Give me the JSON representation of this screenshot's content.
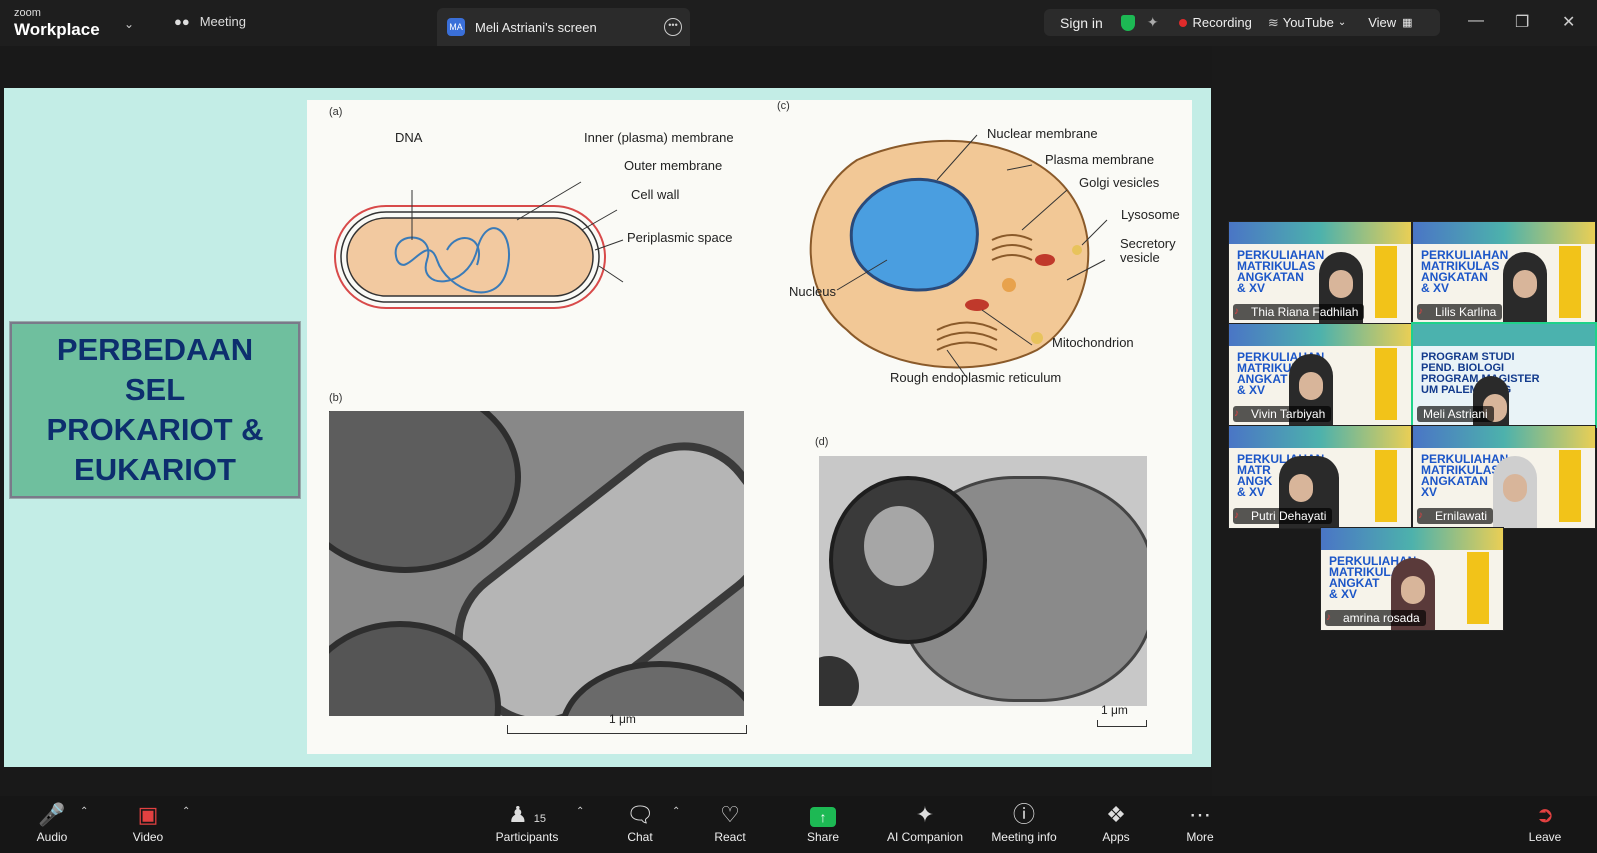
{
  "app": {
    "brand_small": "zoom",
    "brand_big": "Workplace",
    "meeting_label": "Meeting",
    "screen_title": "Meli Astriani's screen",
    "screen_avatar": "MA"
  },
  "top_right": {
    "sign_in": "Sign in",
    "recording": "Recording",
    "youtube": "YouTube",
    "view": "View"
  },
  "slide": {
    "title_lines": [
      "PERBEDAAN",
      "SEL",
      "PROKARIOT &",
      "EUKARIOT"
    ],
    "panel_a": "(a)",
    "panel_b": "(b)",
    "panel_c": "(c)",
    "panel_d": "(d)",
    "prok_labels": {
      "dna": "DNA",
      "inner": "Inner (plasma) membrane",
      "outer": "Outer membrane",
      "wall": "Cell wall",
      "peri": "Periplasmic space"
    },
    "euk_labels": {
      "nuclear": "Nuclear membrane",
      "plasma": "Plasma membrane",
      "golgi": "Golgi vesicles",
      "lyso": "Lysosome",
      "secr1": "Secretory",
      "secr2": "vesicle",
      "nucleus": "Nucleus",
      "mito": "Mitochondrion",
      "rer": "Rough endoplasmic reticulum"
    },
    "scale_b": "1 μm",
    "scale_d": "1 μm"
  },
  "participants": [
    {
      "name": "Thia Riana Fadhilah",
      "slide_text": [
        "PERKULIAHAN",
        "MATRIKULAS",
        "ANGKATAN",
        "& XV"
      ],
      "muted": true
    },
    {
      "name": "Lilis Karlina",
      "slide_text": [
        "PERKULIAHAN",
        "MATRIKULAS",
        "ANGKATAN",
        "& XV"
      ],
      "muted": true
    },
    {
      "name": "Vivin Tarbiyah",
      "slide_text": [
        "PERKULIAHAN",
        "MATRIKULAS",
        "ANGKAT",
        "& XV"
      ],
      "muted": true
    },
    {
      "name": "Meli Astriani",
      "slide_text": [
        "PROGRAM STUDI",
        "PEND. BIOLOGI",
        "PROGRAM MAGISTER",
        "UM PALEMBANG"
      ],
      "muted": false
    },
    {
      "name": "Putri Dehayati",
      "slide_text": [
        "PERKULIAHAN",
        "MATR",
        "ANGK",
        "& XV"
      ],
      "muted": true
    },
    {
      "name": "Ernilawati",
      "slide_text": [
        "PERKULIAHAN",
        "MATRIKULAS",
        "ANGKATAN",
        "XV"
      ],
      "muted": true
    },
    {
      "name": "amrina rosada",
      "slide_text": [
        "PERKULIAHAN",
        "MATRIKULAS",
        "ANGKAT",
        "& XV"
      ],
      "muted": true
    }
  ],
  "toolbar": {
    "audio": "Audio",
    "video": "Video",
    "participants": "Participants",
    "participants_count": "15",
    "chat": "Chat",
    "react": "React",
    "share": "Share",
    "ai": "AI Companion",
    "info": "Meeting info",
    "apps": "Apps",
    "more": "More",
    "leave": "Leave"
  }
}
